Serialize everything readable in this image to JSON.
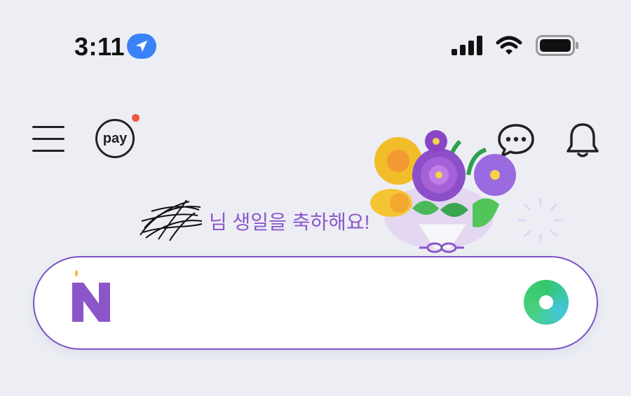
{
  "status_bar": {
    "time": "3:11",
    "location_icon": "location-arrow-icon",
    "signal_icon": "cellular-signal-icon",
    "wifi_icon": "wifi-icon",
    "battery_icon": "battery-icon"
  },
  "header": {
    "menu_icon": "hamburger-menu-icon",
    "pay_label": "pay",
    "pay_notification_color": "#ef5a3c",
    "chat_icon": "chat-bubble-icon",
    "bell_icon": "bell-icon"
  },
  "birthday": {
    "message": "님 생일을 축하해요!",
    "color": "#8b56c9"
  },
  "search": {
    "logo_icon": "naver-n-birthday-candle-logo",
    "green_button_icon": "green-ring-button-icon",
    "border_color": "#7b52c2"
  }
}
